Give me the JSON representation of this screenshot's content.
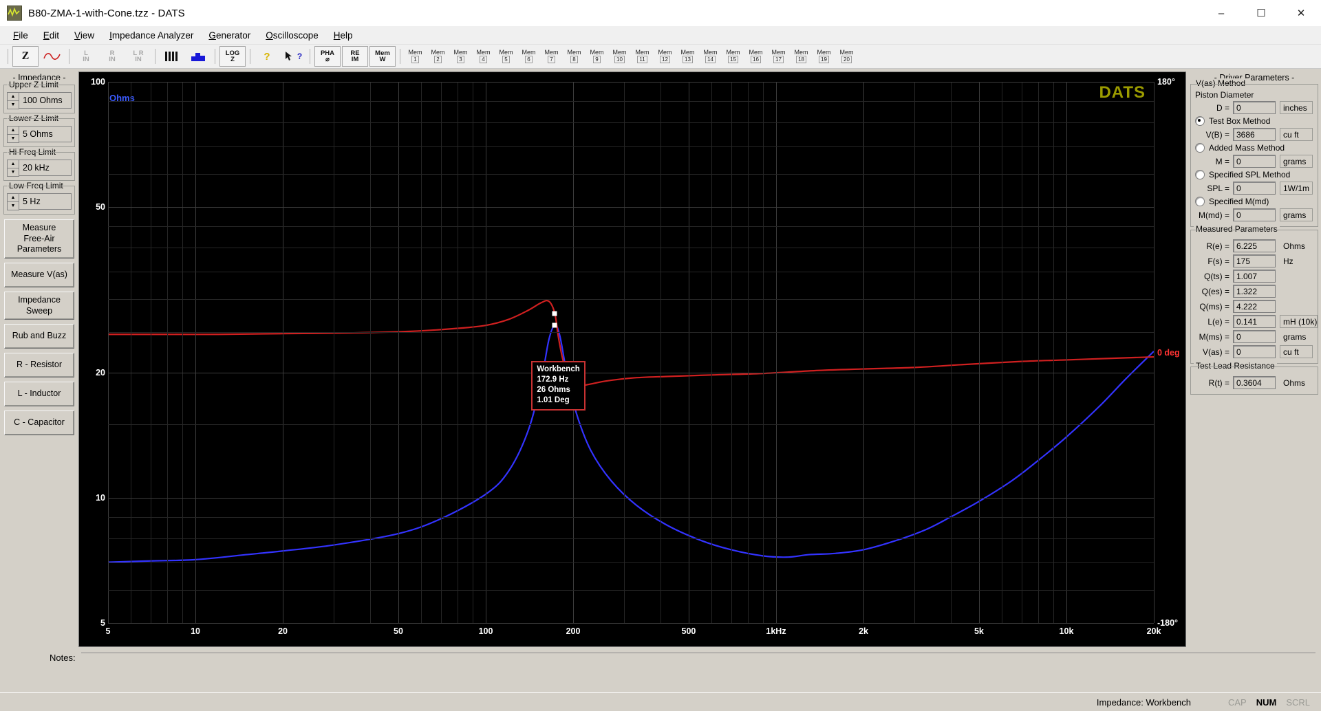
{
  "window": {
    "title": "B80-ZMA-1-with-Cone.tzz - DATS",
    "app_icon": "waveform-icon",
    "minimize": "–",
    "maximize": "☐",
    "close": "✕"
  },
  "menu": [
    {
      "label": "File",
      "accel": "F"
    },
    {
      "label": "Edit",
      "accel": "E"
    },
    {
      "label": "View",
      "accel": "V"
    },
    {
      "label": "Impedance Analyzer",
      "accel": "I"
    },
    {
      "label": "Generator",
      "accel": "G"
    },
    {
      "label": "Oscilloscope",
      "accel": "O"
    },
    {
      "label": "Help",
      "accel": "H"
    }
  ],
  "toolbar": {
    "buttons": [
      {
        "name": "impedance-z-button",
        "label": "Z",
        "dim": false,
        "framed": true
      },
      {
        "name": "sine-wave-button",
        "label": "∿",
        "dim": false,
        "framed": false
      },
      {
        "name": "left-in-button",
        "top": "L",
        "bottom": "IN",
        "dim": true
      },
      {
        "name": "right-in-button",
        "top": "R",
        "bottom": "IN",
        "dim": true
      },
      {
        "name": "left-right-in-button",
        "top": "L R",
        "bottom": "IN",
        "dim": true
      },
      {
        "name": "bars-button",
        "label": "▐▐▐",
        "dim": false
      },
      {
        "name": "blue-step-button",
        "label": "",
        "dim": false
      },
      {
        "name": "log-z-button",
        "top": "LOG",
        "bottom": "Z",
        "framed": true
      },
      {
        "name": "help-question-button",
        "label": "?",
        "dim": false
      },
      {
        "name": "context-help-button",
        "label": "?",
        "dim": false
      },
      {
        "name": "phase-button",
        "top": "PHA",
        "bottom": "⌀",
        "framed": true
      },
      {
        "name": "re-im-button",
        "top": "RE",
        "bottom": "IM",
        "framed": true
      },
      {
        "name": "memory-w-button",
        "top": "Mem",
        "bottom": "W",
        "framed": true
      }
    ],
    "memory_label": "Mem",
    "memory_slots": [
      "1",
      "2",
      "3",
      "4",
      "5",
      "6",
      "7",
      "8",
      "9",
      "10",
      "11",
      "12",
      "13",
      "14",
      "15",
      "16",
      "17",
      "18",
      "19",
      "20"
    ]
  },
  "sidebar": {
    "section_title": "- Impedance -",
    "spinners": [
      {
        "label": "Upper Z Limit",
        "value": "100 Ohms",
        "name": "upper-z-limit"
      },
      {
        "label": "Lower Z Limit",
        "value": "5 Ohms",
        "name": "lower-z-limit"
      },
      {
        "label": "Hi Freq Limit",
        "value": "20 kHz",
        "name": "hi-freq-limit"
      },
      {
        "label": "Low Freq Limit",
        "value": "5 Hz",
        "name": "low-freq-limit"
      }
    ],
    "buttons": [
      {
        "label": "Measure\nFree-Air\nParameters",
        "name": "measure-free-air-parameters-button"
      },
      {
        "label": "Measure V(as)",
        "name": "measure-vas-button"
      },
      {
        "label": "Impedance\nSweep",
        "name": "impedance-sweep-button"
      },
      {
        "label": "Rub and Buzz",
        "name": "rub-and-buzz-button"
      },
      {
        "label": "R - Resistor",
        "name": "r-resistor-button"
      },
      {
        "label": "L - Inductor",
        "name": "l-inductor-button"
      },
      {
        "label": "C - Capacitor",
        "name": "c-capacitor-button"
      }
    ]
  },
  "graph": {
    "logo": "DATS",
    "y_axis_name": "Ohms",
    "y_axis_color": "#3b5bff",
    "phase_zero_label": "0 deg",
    "phase_top_label": "180°",
    "phase_bottom_label": "-180°",
    "phase_label_color": "#ff3333",
    "impedance_color": "#3333ff",
    "phase_curve_color": "#d02020",
    "marker": {
      "title": "Workbench",
      "frequency": "172.9 Hz",
      "impedance": "26 Ohms",
      "phase": "1.01 Deg"
    }
  },
  "chart_data": {
    "type": "line",
    "title": "DATS",
    "xlabel": "",
    "ylabel": "Ohms",
    "xscale": "log",
    "yscale": "log",
    "xlim": [
      5,
      20000
    ],
    "ylim": [
      5,
      100
    ],
    "xticks": [
      {
        "v": 5,
        "label": "5"
      },
      {
        "v": 10,
        "label": "10"
      },
      {
        "v": 20,
        "label": "20"
      },
      {
        "v": 50,
        "label": "50"
      },
      {
        "v": 100,
        "label": "100"
      },
      {
        "v": 200,
        "label": "200"
      },
      {
        "v": 500,
        "label": "500"
      },
      {
        "v": 1000,
        "label": "1kHz"
      },
      {
        "v": 2000,
        "label": "2k"
      },
      {
        "v": 5000,
        "label": "5k"
      },
      {
        "v": 10000,
        "label": "10k"
      },
      {
        "v": 20000,
        "label": "20k"
      }
    ],
    "yticks": [
      {
        "v": 100,
        "label": "100"
      },
      {
        "v": 50,
        "label": "50"
      },
      {
        "v": 20,
        "label": "20"
      },
      {
        "v": 10,
        "label": "10"
      },
      {
        "v": 5,
        "label": "5"
      }
    ],
    "right_axis": {
      "ticks": [
        180,
        0,
        -180
      ],
      "labels": [
        "180°",
        "0 deg",
        "-180°"
      ],
      "unit": "deg"
    },
    "grid": true,
    "legend": null,
    "series": [
      {
        "name": "Impedance",
        "color": "#3333ff",
        "unit": "Ohms",
        "points": [
          [
            5,
            7.0
          ],
          [
            7,
            7.05
          ],
          [
            10,
            7.1
          ],
          [
            15,
            7.3
          ],
          [
            20,
            7.45
          ],
          [
            30,
            7.7
          ],
          [
            50,
            8.2
          ],
          [
            70,
            8.9
          ],
          [
            100,
            10.2
          ],
          [
            120,
            11.6
          ],
          [
            140,
            14.5
          ],
          [
            155,
            19.0
          ],
          [
            165,
            24.0
          ],
          [
            173,
            26.0
          ],
          [
            180,
            24.5
          ],
          [
            190,
            20.0
          ],
          [
            205,
            16.0
          ],
          [
            230,
            13.0
          ],
          [
            270,
            11.0
          ],
          [
            330,
            9.6
          ],
          [
            420,
            8.6
          ],
          [
            550,
            7.9
          ],
          [
            700,
            7.5
          ],
          [
            900,
            7.25
          ],
          [
            1100,
            7.2
          ],
          [
            1300,
            7.3
          ],
          [
            1600,
            7.35
          ],
          [
            2000,
            7.5
          ],
          [
            2600,
            7.9
          ],
          [
            3300,
            8.4
          ],
          [
            4000,
            9.0
          ],
          [
            5000,
            9.8
          ],
          [
            6500,
            11.0
          ],
          [
            8000,
            12.3
          ],
          [
            10000,
            14.0
          ],
          [
            13000,
            16.6
          ],
          [
            16000,
            19.3
          ],
          [
            20000,
            22.5
          ]
        ]
      },
      {
        "name": "Phase",
        "color": "#d02020",
        "unit": "deg",
        "points": [
          [
            5,
            12
          ],
          [
            8,
            12
          ],
          [
            12,
            12
          ],
          [
            20,
            12.5
          ],
          [
            35,
            13
          ],
          [
            55,
            14
          ],
          [
            80,
            16
          ],
          [
            100,
            18
          ],
          [
            120,
            22
          ],
          [
            140,
            28
          ],
          [
            155,
            33
          ],
          [
            165,
            34
          ],
          [
            172.9,
            26
          ],
          [
            178,
            10
          ],
          [
            185,
            -6
          ],
          [
            195,
            -18
          ],
          [
            210,
            -22
          ],
          [
            230,
            -21
          ],
          [
            260,
            -19
          ],
          [
            320,
            -17
          ],
          [
            420,
            -16
          ],
          [
            600,
            -15
          ],
          [
            900,
            -14
          ],
          [
            1400,
            -12
          ],
          [
            2000,
            -11
          ],
          [
            3000,
            -10
          ],
          [
            4500,
            -8
          ],
          [
            7000,
            -6
          ],
          [
            10000,
            -5
          ],
          [
            14000,
            -4
          ],
          [
            20000,
            -3
          ]
        ]
      }
    ],
    "annotations": [
      {
        "type": "marker",
        "label": "Workbench",
        "frequency": 172.9,
        "impedance": 26,
        "phase": 1.01
      }
    ]
  },
  "driver_parameters": {
    "title": "- Driver Parameters -",
    "vas_method": {
      "group_label": "V(as) Method",
      "piston_label": "Piston Diameter",
      "diameter": {
        "label": "D =",
        "value": "0",
        "unit": "inches"
      },
      "methods": [
        {
          "label": "Test Box Method",
          "selected": true,
          "field": {
            "label": "V(B) =",
            "value": "3686",
            "unit": "cu ft"
          }
        },
        {
          "label": "Added Mass Method",
          "selected": false,
          "field": {
            "label": "M =",
            "value": "0",
            "unit": "grams"
          }
        },
        {
          "label": "Specified SPL Method",
          "selected": false,
          "field": {
            "label": "SPL =",
            "value": "0",
            "unit": "1W/1m"
          }
        },
        {
          "label": "Specified M(md)",
          "selected": false,
          "field": {
            "label": "M(md) =",
            "value": "0",
            "unit": "grams"
          }
        }
      ]
    },
    "measured": {
      "group_label": "Measured Parameters",
      "rows": [
        {
          "label": "R(e) =",
          "value": "6.225",
          "unit": "Ohms"
        },
        {
          "label": "F(s) =",
          "value": "175",
          "unit": "Hz"
        },
        {
          "label": "Q(ts) =",
          "value": "1.007",
          "unit": ""
        },
        {
          "label": "Q(es) =",
          "value": "1.322",
          "unit": ""
        },
        {
          "label": "Q(ms) =",
          "value": "4.222",
          "unit": ""
        },
        {
          "label": "L(e) =",
          "value": "0.141",
          "unit": "mH (10k)"
        },
        {
          "label": "M(ms) =",
          "value": "0",
          "unit": "grams"
        },
        {
          "label": "V(as) =",
          "value": "0",
          "unit": "cu ft"
        }
      ]
    },
    "test_lead": {
      "group_label": "Test Lead Resistance",
      "row": {
        "label": "R(t) =",
        "value": "0.3604",
        "unit": "Ohms"
      }
    }
  },
  "notes": {
    "label": "Notes:",
    "value": ""
  },
  "statusbar": {
    "message": "Impedance: Workbench",
    "indicators": [
      {
        "label": "CAP",
        "active": false
      },
      {
        "label": "NUM",
        "active": true
      },
      {
        "label": "SCRL",
        "active": false
      }
    ]
  }
}
